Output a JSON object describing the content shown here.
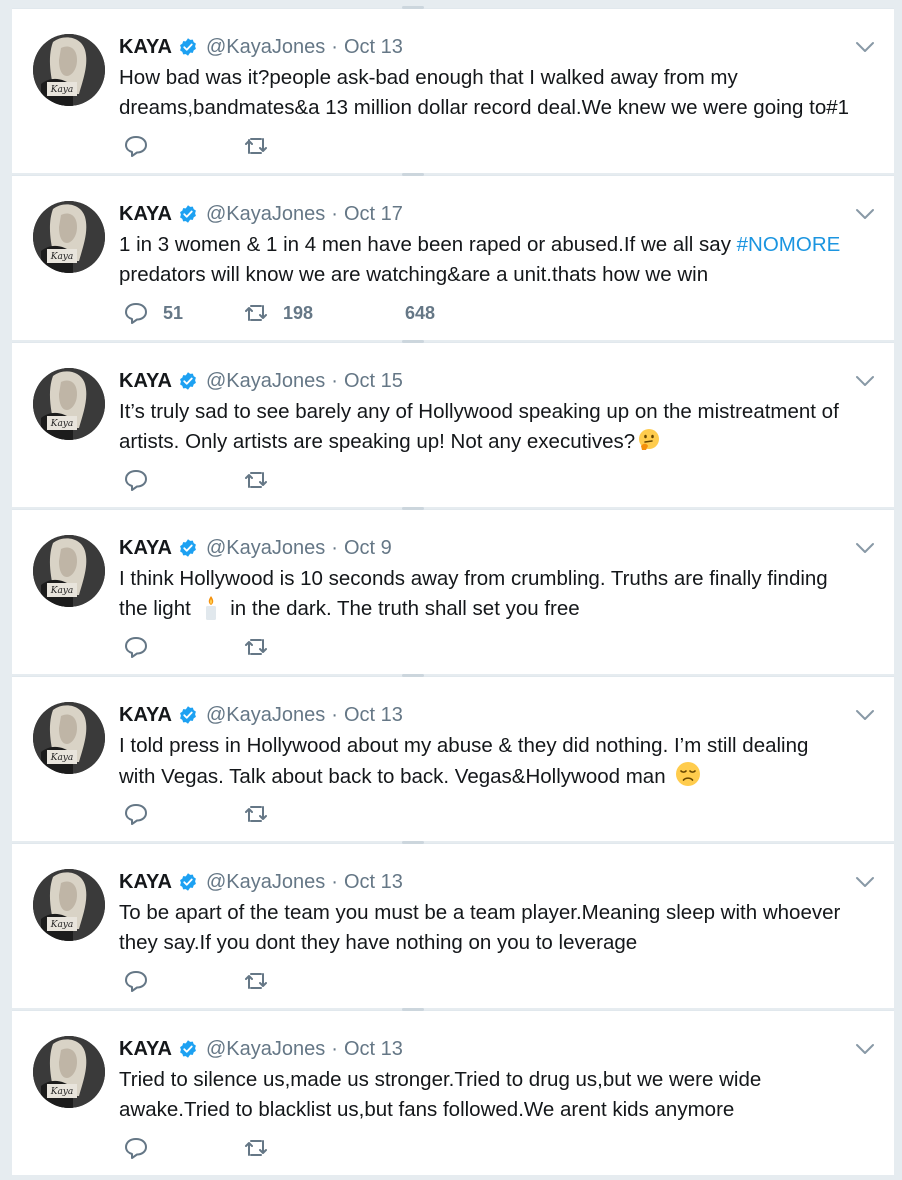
{
  "colors": {
    "background": "#e6ecf0",
    "card": "#ffffff",
    "text": "#14171a",
    "muted": "#657786",
    "link": "#1b95e0",
    "verified": "#1da1f2"
  },
  "tweets": [
    {
      "name": "KAYA",
      "handle": "@KayaJones",
      "separator": "·",
      "date": "Oct 13",
      "lines": [
        "How bad was it?people ask-bad enough that I walked away from my",
        "dreams,bandmates&a 13 million dollar record deal.We knew we were going to#1"
      ],
      "replies": "",
      "retweets": "",
      "likes": ""
    },
    {
      "name": "KAYA",
      "handle": "@KayaJones",
      "separator": "·",
      "date": "Oct 17",
      "line1_prefix": "1 in 3 women & 1 in 4 men have been raped or abused.If we all say ",
      "line1_hashtag": "#NOMORE",
      "line2": "predators will know we are watching&are a unit.thats how we win",
      "replies": "51",
      "retweets": "198",
      "likes": "648"
    },
    {
      "name": "KAYA",
      "handle": "@KayaJones",
      "separator": "·",
      "date": "Oct 15",
      "lines": [
        "It’s truly sad to see barely any of Hollywood speaking up on the mistreatment of",
        "artists. Only artists are speaking up! Not any executives?"
      ],
      "emoji": "thinking-face",
      "replies": "",
      "retweets": "",
      "likes": ""
    },
    {
      "name": "KAYA",
      "handle": "@KayaJones",
      "separator": "·",
      "date": "Oct 9",
      "line1": "I think Hollywood is 10 seconds away from crumbling. Truths are finally finding",
      "line2_prefix": "the light",
      "line2_suffix": "in the dark. The truth shall set you free",
      "emoji": "candle",
      "replies": "",
      "retweets": "",
      "likes": ""
    },
    {
      "name": "KAYA",
      "handle": "@KayaJones",
      "separator": "·",
      "date": "Oct 13",
      "lines": [
        "I told press in Hollywood about my abuse & they did nothing. I’m still dealing",
        "with Vegas. Talk about back to back. Vegas&Hollywood man"
      ],
      "emoji": "disappointed-face",
      "replies": "",
      "retweets": "",
      "likes": ""
    },
    {
      "name": "KAYA",
      "handle": "@KayaJones",
      "separator": "·",
      "date": "Oct 13",
      "lines": [
        "To be apart of the team you must be a team player.Meaning sleep with whoever",
        "they say.If you dont they have nothing on you to leverage"
      ],
      "replies": "",
      "retweets": "",
      "likes": ""
    },
    {
      "name": "KAYA",
      "handle": "@KayaJones",
      "separator": "·",
      "date": "Oct 13",
      "lines": [
        "Tried to silence us,made us stronger.Tried to drug us,but we were wide",
        "awake.Tried to blacklist us,but fans followed.We arent kids anymore"
      ],
      "replies": "",
      "retweets": "",
      "likes": ""
    }
  ],
  "avatar_caption": "Kaya",
  "icons": {
    "reply": "reply-icon",
    "retweet": "retweet-icon",
    "like": "like-icon",
    "verified": "verified-badge-icon",
    "caret": "chevron-down-icon"
  }
}
